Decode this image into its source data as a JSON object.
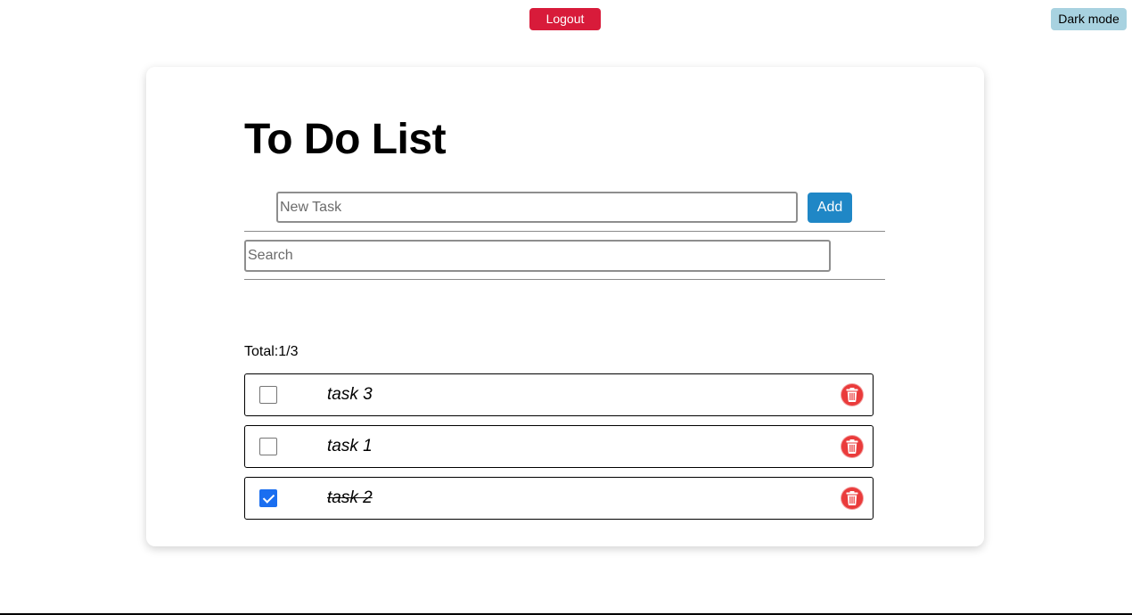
{
  "header": {
    "logout_label": "Logout",
    "dark_mode_label": "Dark mode"
  },
  "card": {
    "title": "To Do List",
    "new_task": {
      "placeholder": "New Task",
      "value": ""
    },
    "add_label": "Add",
    "search": {
      "placeholder": "Search",
      "value": ""
    },
    "total_text": "Total:1/3",
    "tasks": [
      {
        "text": "task 3",
        "completed": false
      },
      {
        "text": "task 1",
        "completed": false
      },
      {
        "text": "task 2",
        "completed": true
      }
    ]
  },
  "colors": {
    "logout": "#d81b3a",
    "dark_mode": "#a8d2e0",
    "add": "#1f87c6",
    "delete": "#ea3b3b",
    "checkbox_checked": "#1a6ef0"
  },
  "icons": {
    "delete": "trash-icon"
  }
}
